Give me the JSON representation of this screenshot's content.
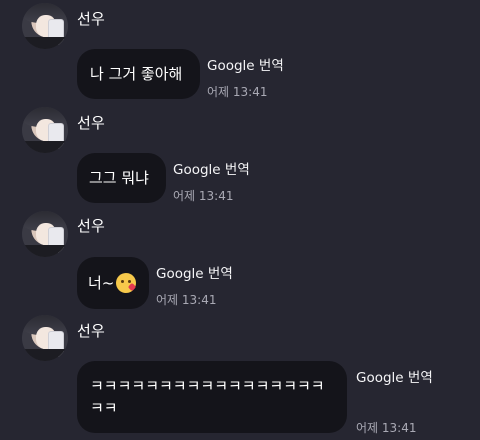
{
  "messages": [
    {
      "sender": "선우",
      "text": "나 그거 좋아해",
      "translate_label": "Google 번역",
      "time": "어제 13:41"
    },
    {
      "sender": "선우",
      "text": "그그 뭐냐",
      "translate_label": "Google 번역",
      "time": "어제 13:41"
    },
    {
      "sender": "선우",
      "text": "너~",
      "emoji": "kissing-face-with-heart-emoji",
      "translate_label": "Google 번역",
      "time": "어제 13:41"
    },
    {
      "sender": "선우",
      "text": "ㅋㅋㅋㅋㅋㅋㅋㅋㅋㅋㅋㅋㅋㅋㅋㅋㅋ\nㅋㅋ",
      "translate_label": "Google 번역",
      "time": "어제 13:41"
    }
  ],
  "colors": {
    "background": "#262631",
    "bubble": "#14141a",
    "time": "#a9a9b4"
  }
}
